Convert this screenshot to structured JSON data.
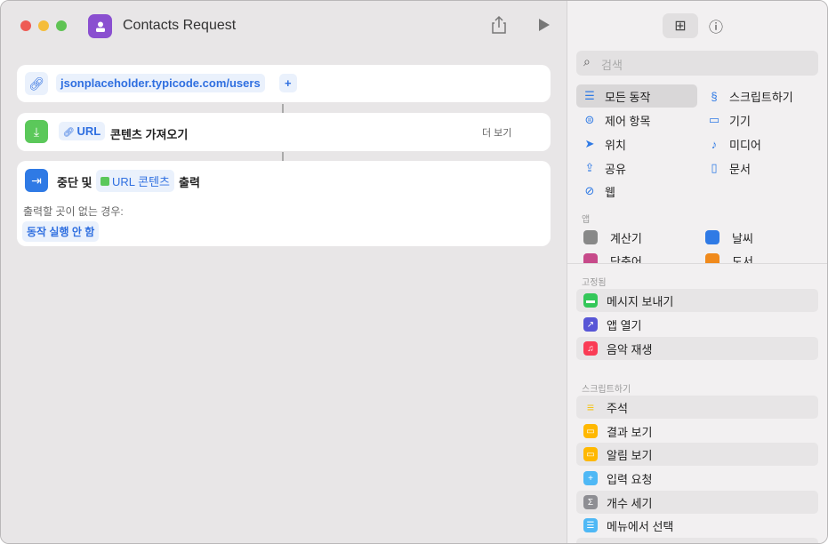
{
  "window": {
    "title": "Contacts Request"
  },
  "workflow": {
    "url_value": "jsonplaceholder.typicode.com/users",
    "add_label": "+",
    "get_contents": {
      "token": "URL",
      "label": "콘텐츠 가져오기",
      "more": "더 보기"
    },
    "stop_output": {
      "prefix": "중단 및",
      "token": "URL 콘텐츠",
      "suffix": "출력",
      "fallback_label": "출력할 곳이 없는 경우:",
      "fallback_value": "동작 실행 안 함"
    }
  },
  "library": {
    "search_placeholder": "검색",
    "categories": [
      {
        "label": "모든 동작",
        "icon": "list-icon"
      },
      {
        "label": "스크립트하기",
        "icon": "script-icon"
      },
      {
        "label": "제어 항목",
        "icon": "toggle-icon"
      },
      {
        "label": "기기",
        "icon": "display-icon"
      },
      {
        "label": "위치",
        "icon": "location-icon"
      },
      {
        "label": "미디어",
        "icon": "music-note-icon"
      },
      {
        "label": "공유",
        "icon": "share-icon"
      },
      {
        "label": "문서",
        "icon": "document-icon"
      },
      {
        "label": "웹",
        "icon": "compass-icon"
      }
    ],
    "apps_header": "앱",
    "apps": [
      {
        "label": "계산기"
      },
      {
        "label": "날씨"
      },
      {
        "label": "단축어"
      },
      {
        "label": "도서"
      }
    ],
    "pinned_header": "고정됨",
    "pinned": [
      {
        "label": "메시지 보내기",
        "color": "#34c759"
      },
      {
        "label": "앱 열기",
        "color": "#5856d6"
      },
      {
        "label": "음악 재생",
        "color": "#fa3c55"
      }
    ],
    "scripting_header": "스크립트하기",
    "scripting": [
      {
        "label": "주석",
        "color": "#f5c518"
      },
      {
        "label": "결과 보기",
        "color": "#ffb800"
      },
      {
        "label": "알림 보기",
        "color": "#ffb800"
      },
      {
        "label": "입력 요청",
        "color": "#4fb8f5"
      },
      {
        "label": "개수 세기",
        "color": "#8e8e93"
      },
      {
        "label": "메뉴에서 선택",
        "color": "#4fb8f5"
      }
    ]
  }
}
